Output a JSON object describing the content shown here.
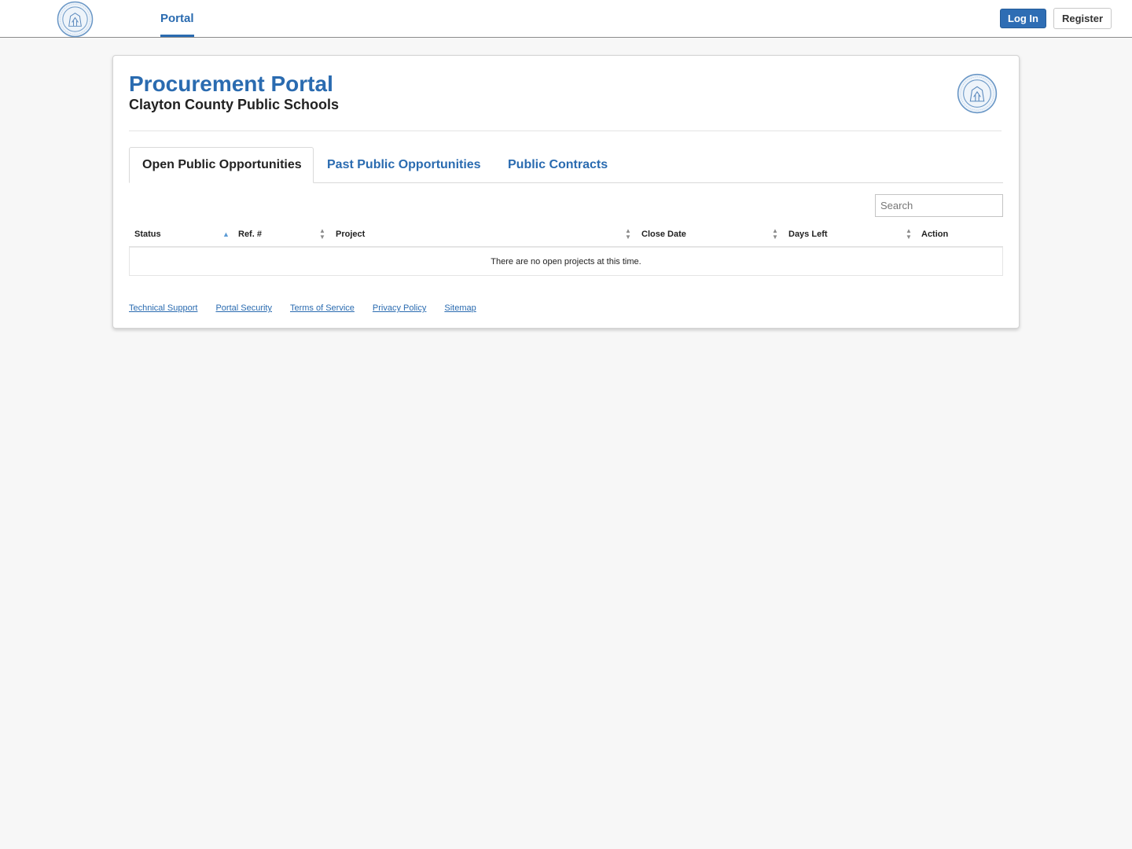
{
  "header": {
    "nav_portal": "Portal",
    "login_label": "Log In",
    "register_label": "Register",
    "logo_icon": "district-seal-icon"
  },
  "main": {
    "title": "Procurement Portal",
    "subtitle": "Clayton County Public Schools",
    "tabs": [
      {
        "label": "Open Public Opportunities",
        "active": true
      },
      {
        "label": "Past Public Opportunities",
        "active": false
      },
      {
        "label": "Public Contracts",
        "active": false
      }
    ],
    "search": {
      "placeholder": "Search",
      "value": ""
    },
    "table": {
      "columns": [
        "Status",
        "Ref. #",
        "Project",
        "Close Date",
        "Days Left",
        "Action"
      ],
      "sorted_column": "Status",
      "sort_direction": "ascending",
      "empty_message": "There are no open projects at this time."
    }
  },
  "footer": {
    "links": [
      "Technical Support",
      "Portal Security",
      "Terms of Service",
      "Privacy Policy",
      "Sitemap"
    ]
  },
  "colors": {
    "accent": "#2a6bb0",
    "primary_button": "#2e6db4",
    "background": "#f7f7f7"
  }
}
